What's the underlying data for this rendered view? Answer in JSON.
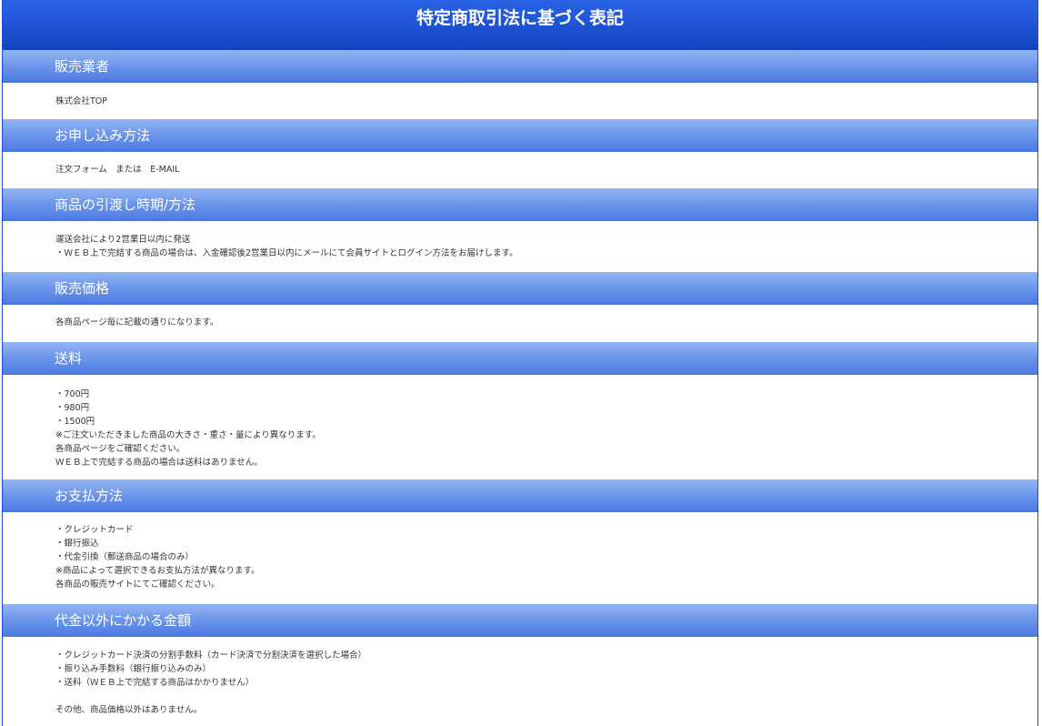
{
  "page_title": "特定商取引法に基づく表記",
  "sections": [
    {
      "heading": "販売業者",
      "lines": [
        "株式会社TOP"
      ]
    },
    {
      "heading": "お申し込み方法",
      "lines": [
        "注文フォーム　または　E-MAIL"
      ]
    },
    {
      "heading": "商品の引渡し時期/方法",
      "lines": [
        "運送会社により2営業日以内に発送",
        "・ＷＥＢ上で完結する商品の場合は、入金確認後2営業日以内にメールにて会員サイトとログイン方法をお届けします。"
      ]
    },
    {
      "heading": "販売価格",
      "lines": [
        "各商品ページ毎に記載の通りになります。"
      ]
    },
    {
      "heading": "送料",
      "lines": [
        "・700円",
        "・980円",
        "・1500円",
        "※ご注文いただきました商品の大きさ・重さ・量により異なります。",
        "各商品ページをご確認ください。",
        "ＷＥＢ上で完結する商品の場合は送料はありません。"
      ]
    },
    {
      "heading": "お支払方法",
      "lines": [
        "・クレジットカード",
        "・銀行振込",
        "・代金引換（郵送商品の場合のみ）",
        "※商品によって選択できるお支払方法が異なります。",
        "各商品の販売サイトにてご確認ください。"
      ]
    },
    {
      "heading": "代金以外にかかる金額",
      "lines": [
        "・クレジットカード決済の分割手数料（カード決済で分割決済を選択した場合）",
        "・振り込み手数料（銀行振り込みのみ）",
        "・送料（ＷＥＢ上で完結する商品はかかりません）",
        "",
        "その他、商品価格以外はありません。"
      ]
    }
  ]
}
